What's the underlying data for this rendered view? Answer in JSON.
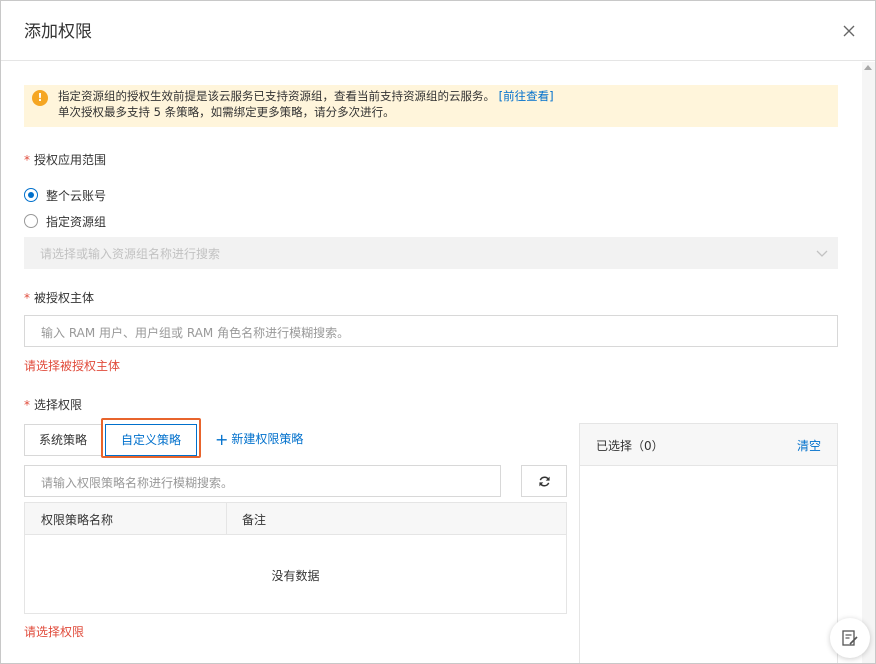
{
  "dialog": {
    "title": "添加权限"
  },
  "notice": {
    "line1": "指定资源组的授权生效前提是该云服务已支持资源组，查看当前支持资源组的云服务。",
    "link": "[前往查看]",
    "line2": "单次授权最多支持 5 条策略，如需绑定更多策略，请分多次进行。"
  },
  "scope": {
    "label": "授权应用范围",
    "required_mark": "*",
    "options": [
      {
        "label": "整个云账号",
        "checked": true
      },
      {
        "label": "指定资源组",
        "checked": false
      }
    ],
    "resource_group_placeholder": "请选择或输入资源组名称进行搜索"
  },
  "principal": {
    "label": "被授权主体",
    "required_mark": "*",
    "placeholder": "输入 RAM 用户、用户组或 RAM 角色名称进行模糊搜索。",
    "error": "请选择被授权主体"
  },
  "permissions": {
    "label": "选择权限",
    "required_mark": "*",
    "tabs": {
      "system": "系统策略",
      "custom": "自定义策略"
    },
    "new_policy": "新建权限策略",
    "search_placeholder": "请输入权限策略名称进行模糊搜索。",
    "table": {
      "columns": [
        "权限策略名称",
        "备注"
      ],
      "empty": "没有数据"
    },
    "error": "请选择权限",
    "selected": {
      "title": "已选择（0）",
      "clear": "清空"
    }
  },
  "colors": {
    "accent": "#0070cc",
    "error": "#e04b3b",
    "highlight": "#e8642c",
    "notice_bg": "#fff5db",
    "warning": "#f5a623"
  }
}
